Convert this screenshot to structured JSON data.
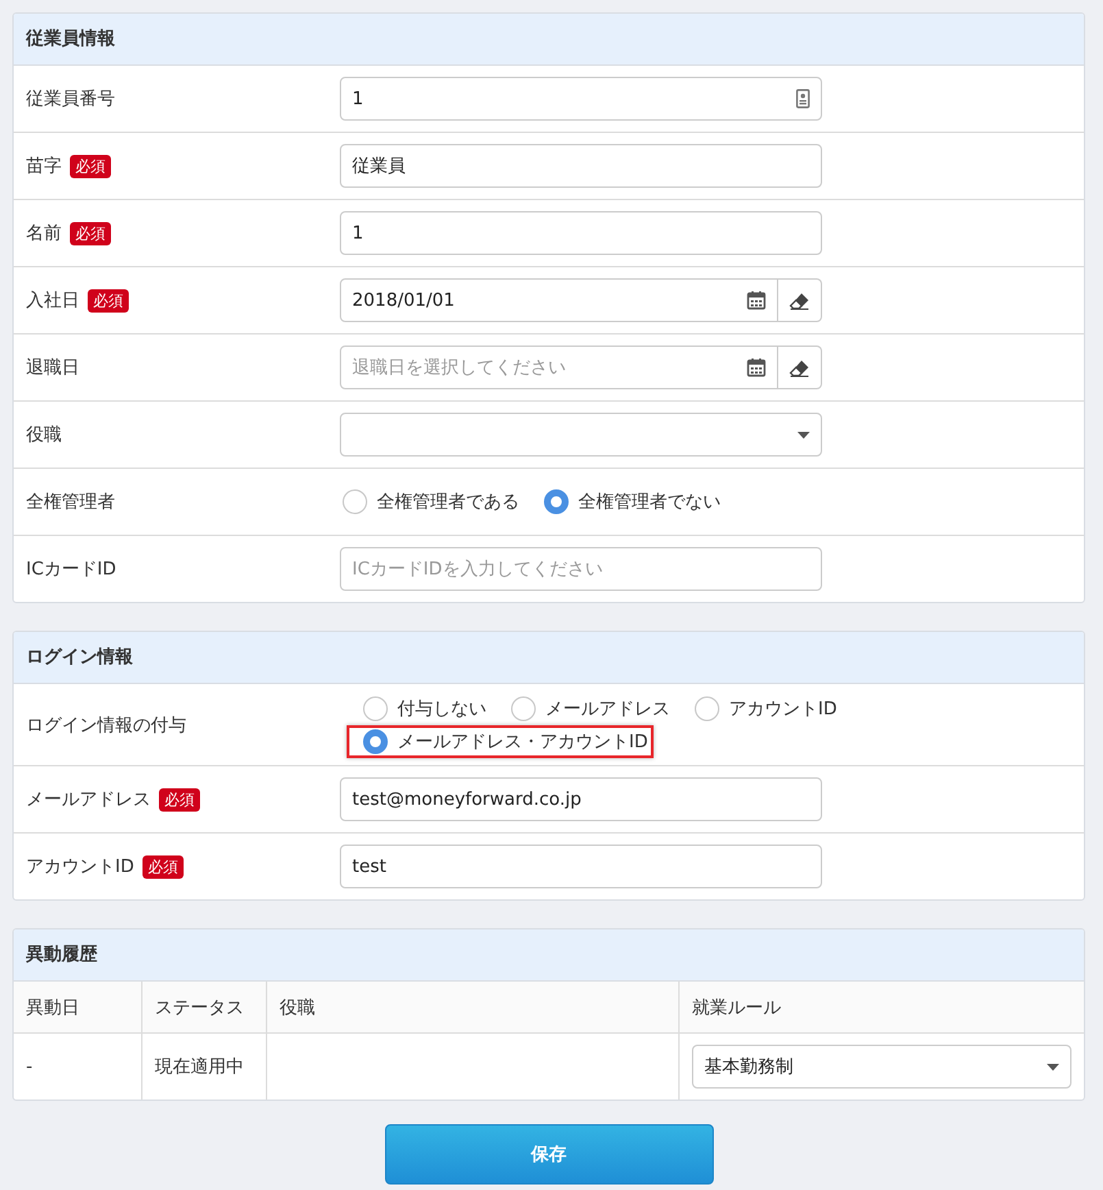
{
  "sections": [
    {
      "title": "従業員情報",
      "rows": [
        {
          "label": "従業員番号",
          "kind": "number",
          "value": "1"
        },
        {
          "label": "苗字",
          "badge": "必須",
          "kind": "text",
          "value": "従業員"
        },
        {
          "label": "名前",
          "badge": "必須",
          "kind": "text",
          "value": "1"
        },
        {
          "label": "入社日",
          "badge": "必須",
          "kind": "date",
          "value": "2018/01/01"
        },
        {
          "label": "退職日",
          "kind": "date",
          "placeholder": "退職日を選択してください"
        },
        {
          "label": "役職",
          "kind": "select"
        },
        {
          "label": "全権管理者",
          "kind": "radio",
          "options": [
            {
              "label": "全権管理者である",
              "selected": false,
              "highlighted": false
            },
            {
              "label": "全権管理者でない",
              "selected": true,
              "highlighted": false
            }
          ]
        },
        {
          "label": "ICカードID",
          "kind": "text",
          "placeholder": "ICカードIDを入力してください"
        }
      ]
    },
    {
      "title": "ログイン情報",
      "rows": [
        {
          "label": "ログイン情報の付与",
          "kind": "radio",
          "options": [
            {
              "label": "付与しない",
              "selected": false,
              "highlighted": false
            },
            {
              "label": "メールアドレス",
              "selected": false,
              "highlighted": false
            },
            {
              "label": "アカウントID",
              "selected": false,
              "highlighted": false
            },
            {
              "label": "メールアドレス・アカウントID",
              "selected": true,
              "highlighted": true
            }
          ]
        },
        {
          "label": "メールアドレス",
          "badge": "必須",
          "kind": "text",
          "value": "test@moneyforward.co.jp"
        },
        {
          "label": "アカウントID",
          "badge": "必須",
          "kind": "text",
          "value": "test"
        }
      ]
    }
  ],
  "history": {
    "title": "異動履歴",
    "columns": [
      "異動日",
      "ステータス",
      "役職",
      "就業ルール"
    ],
    "rows": [
      [
        {
          "kind": "text",
          "text": "-"
        },
        {
          "kind": "text",
          "text": "現在適用中"
        },
        {
          "kind": "empty"
        },
        {
          "kind": "select",
          "value": "基本勤務制"
        }
      ]
    ]
  },
  "save_button": "保存"
}
